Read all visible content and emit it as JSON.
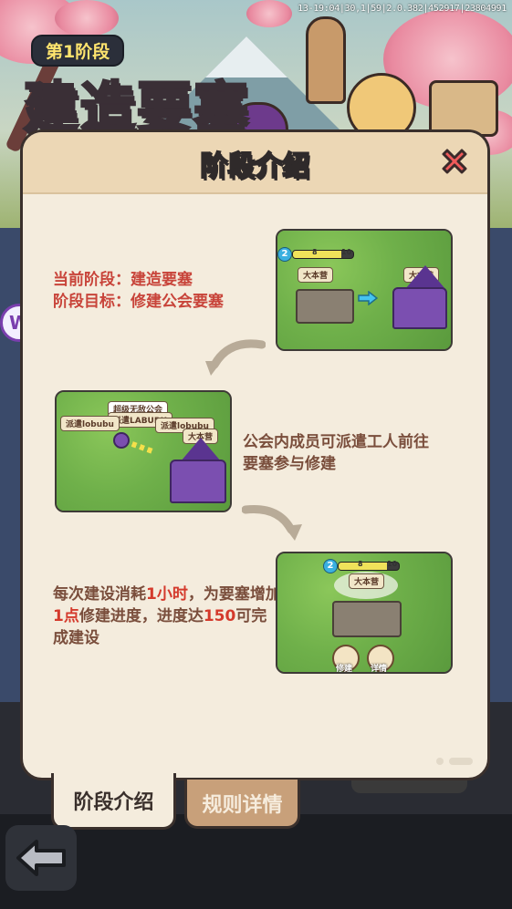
{
  "status_bar": {
    "debug_text": "13-19:04|30,1|59|2.0.382|452917|23804991"
  },
  "header": {
    "stage_label": "第1阶段",
    "stage_title": "建造要塞"
  },
  "side_badge": {
    "letter": "W"
  },
  "modal": {
    "title": "阶段介绍",
    "section1": {
      "line1": "当前阶段：建造要塞",
      "line2": "阶段目标：修建公会要塞",
      "image": {
        "level": "2",
        "count": "8",
        "max": "10",
        "tag_left": "大本营",
        "tag_right": "大本营"
      }
    },
    "section2": {
      "line1": "公会内成员可派遣工人前往",
      "line2": "要塞参与修建",
      "image": {
        "guild_name": "超级无敌公会",
        "member": "派遣LABUBU",
        "tag_a": "派遣lobubu",
        "tag_b": "派遣lobubu",
        "tag_main": "大本营"
      }
    },
    "section3": {
      "part1": "每次建设消耗",
      "hl1": "1小时",
      "part2": "，为要塞增加",
      "hl2": "1点",
      "part3": "修建进度，进度达",
      "hl3": "150",
      "part4": "可完成建设",
      "image": {
        "level": "2",
        "count": "8",
        "max": "10",
        "tag_main": "大本营",
        "build_label": "修建",
        "detail_label": "详情"
      }
    }
  },
  "tabs": [
    {
      "label": "阶段介绍",
      "active": true
    },
    {
      "label": "规则详情",
      "active": false
    }
  ],
  "colors": {
    "highlight": "#d43a2c",
    "brown_text": "#7a4e3c",
    "panel": "#f4ecdd"
  }
}
